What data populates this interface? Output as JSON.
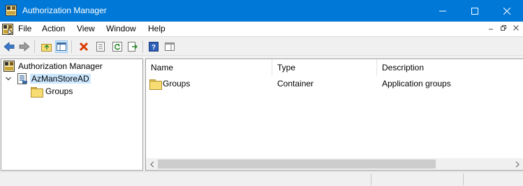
{
  "window": {
    "title": "Authorization Manager"
  },
  "menu": [
    "File",
    "Action",
    "View",
    "Window",
    "Help"
  ],
  "tree": {
    "root": "Authorization Manager",
    "store": "AzManStoreAD",
    "child": "Groups"
  },
  "list": {
    "columns": [
      "Name",
      "Type",
      "Description"
    ],
    "rows": [
      {
        "name": "Groups",
        "type": "Container",
        "description": "Application groups"
      }
    ]
  },
  "colors": {
    "titlebar": "#0078d7",
    "selection": "#cce8ff",
    "error_x": "#d83b01"
  }
}
